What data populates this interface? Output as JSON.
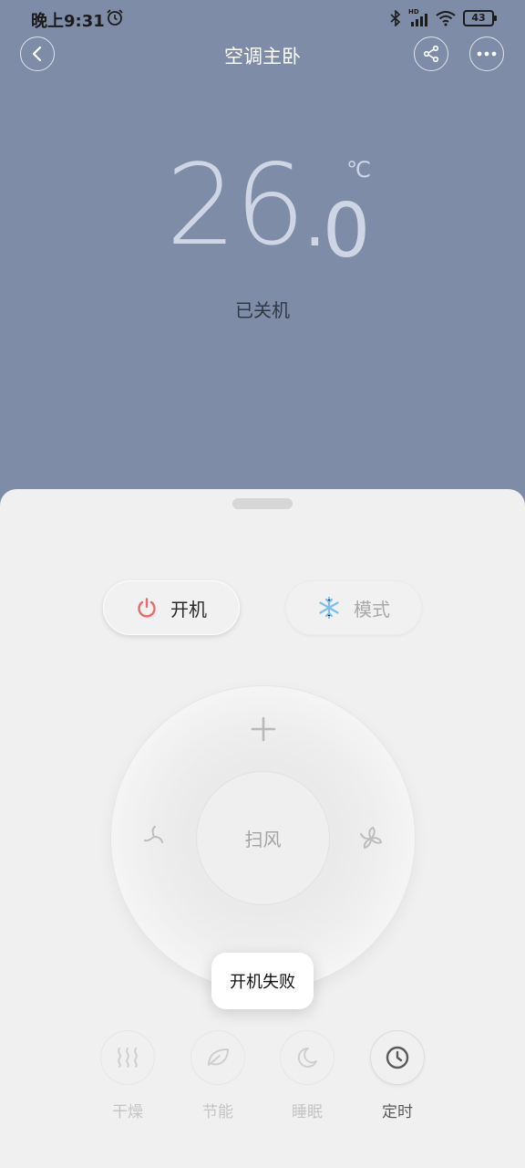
{
  "status_bar": {
    "time": "晚上9:31",
    "signal_label": "HD",
    "battery": "43"
  },
  "header": {
    "title": "空调主卧"
  },
  "display": {
    "temp_integer": "26",
    "temp_dot": ".",
    "temp_decimal": "0",
    "unit": "℃",
    "state": "已关机"
  },
  "controls": {
    "power_label": "开机",
    "mode_label": "模式",
    "swing_label": "扫风"
  },
  "functions": [
    {
      "label": "干燥",
      "icon": "dry-icon",
      "active": false
    },
    {
      "label": "节能",
      "icon": "leaf-icon",
      "active": false
    },
    {
      "label": "睡眠",
      "icon": "moon-icon",
      "active": false
    },
    {
      "label": "定时",
      "icon": "clock-icon",
      "active": true
    }
  ],
  "toast": {
    "message": "开机失败"
  },
  "colors": {
    "header_bg": "#7f8ca7",
    "sheet_bg": "#f0f0f0",
    "power_icon": "#e86a6a",
    "snow_icon": "#7cc0e8"
  }
}
